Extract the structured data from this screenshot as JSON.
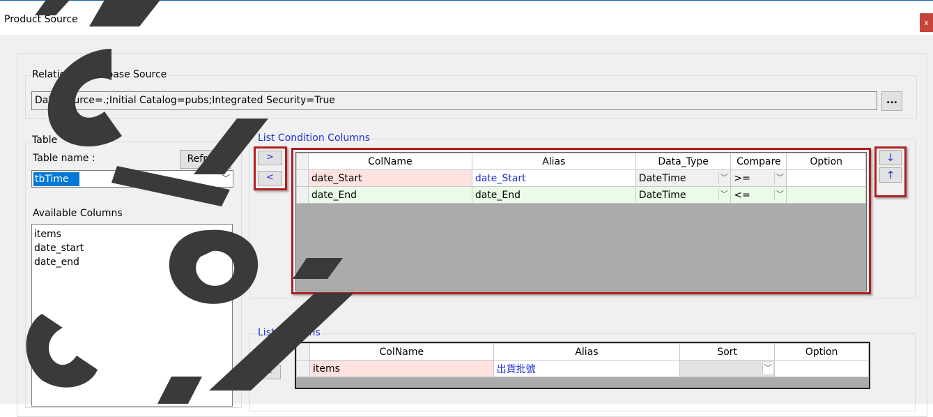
{
  "window": {
    "title": "Product Source",
    "close_icon": "x"
  },
  "relational": {
    "group_label": "Relational Database Source",
    "connection_string": "Data Source=.;Initial Catalog=pubs;Integrated Security=True",
    "browse_label": "..."
  },
  "table": {
    "group_label": "Table",
    "name_label": "Table name :",
    "refresh_label": "Refresh",
    "selected_table": "tbTime",
    "available_label": "Available Columns",
    "available_columns": [
      "items",
      "date_start",
      "date_end"
    ]
  },
  "condition": {
    "group_label": "List Condition Columns",
    "add_label": ">",
    "remove_label": "<",
    "down_label": "↓",
    "up_label": "↑",
    "headers": [
      "ColName",
      "Alias",
      "Data_Type",
      "Compare",
      "Option"
    ],
    "rows": [
      {
        "colname": "date_Start",
        "alias": "date_Start",
        "data_type": "DateTime",
        "compare": ">=",
        "option": ""
      },
      {
        "colname": "date_End",
        "alias": "date_End",
        "data_type": "DateTime",
        "compare": "<=",
        "option": ""
      }
    ]
  },
  "list": {
    "group_label": "List Columns",
    "add_label": ">",
    "remove_label": "<",
    "headers": [
      "ColName",
      "Alias",
      "Sort",
      "Option"
    ],
    "rows": [
      {
        "colname": "items",
        "alias": "出貨批號",
        "sort": "",
        "option": ""
      }
    ]
  },
  "colors": {
    "accent_red": "#b01e1e",
    "selection_blue": "#0078d7",
    "label_blue": "#1e2fd6"
  }
}
